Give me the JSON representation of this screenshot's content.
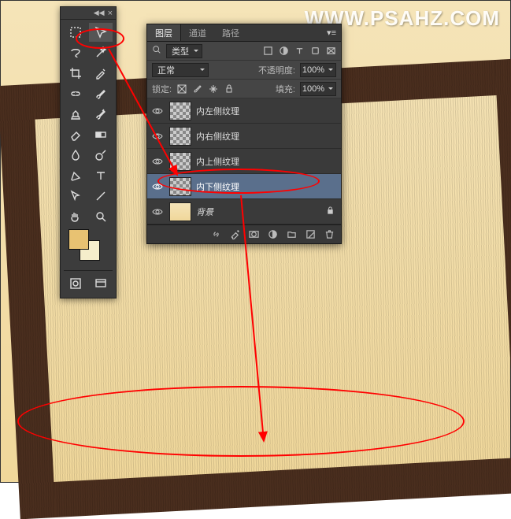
{
  "watermark": "WWW.PSAHZ.COM",
  "layersPanel": {
    "tabs": {
      "layers": "图层",
      "channels": "通道",
      "paths": "路径"
    },
    "filterType": "类型",
    "blendMode": "正常",
    "opacityLabel": "不透明度:",
    "opacityValue": "100%",
    "lockLabel": "锁定:",
    "fillLabel": "填充:",
    "fillValue": "100%",
    "layers": [
      {
        "name": "内左侧纹理"
      },
      {
        "name": "内右侧纹理"
      },
      {
        "name": "内上侧纹理"
      },
      {
        "name": "内下侧纹理"
      },
      {
        "name": "背景"
      }
    ]
  },
  "colors": {
    "fg": "#e8c272",
    "bg": "#f5eecb"
  }
}
